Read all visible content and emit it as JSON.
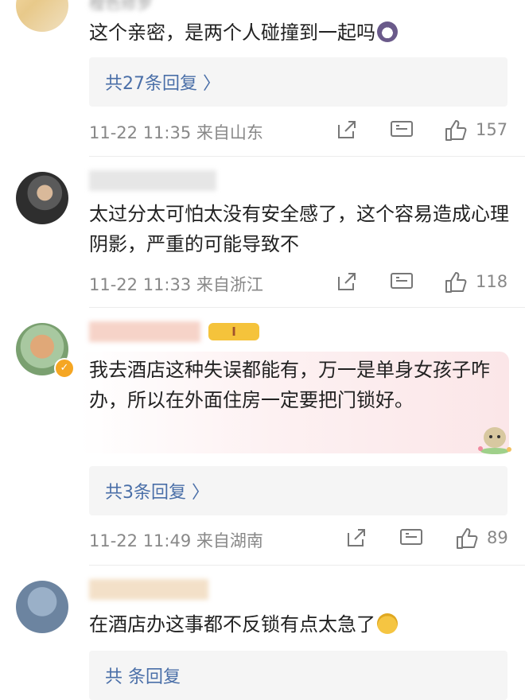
{
  "comments": [
    {
      "username": "橙色修罗",
      "text": "这个亲密，是两个人碰撞到一起吗",
      "reply_link": "共27条回复 〉",
      "time_location": "11-22 11:35  来自山东",
      "likes": "157"
    },
    {
      "username": "",
      "text": "太过分太可怕太没有安全感了，这个容易造成心理阴影，严重的可能导致不",
      "time_location": "11-22 11:33  来自浙江",
      "likes": "118"
    },
    {
      "username": "",
      "level": "I",
      "text": "我去酒店这种失误都能有，万一是单身女孩子咋办，所以在外面住房一定要把门锁好。",
      "reply_link": "共3条回复 〉",
      "time_location": "11-22 11:49  来自湖南",
      "likes": "89"
    },
    {
      "username": "",
      "text": "在酒店办这事都不反锁有点太急了",
      "reply_link": "共 条回复"
    }
  ],
  "icons": [
    "share-icon",
    "comment-icon",
    "like-icon",
    "emoji-icon",
    "verified-icon"
  ],
  "colors": {
    "link": "#4a6fa8",
    "meta": "#888888",
    "reply_bg": "#f5f5f5",
    "verified": "#f5a623",
    "level_badge": "#f5c33b"
  }
}
